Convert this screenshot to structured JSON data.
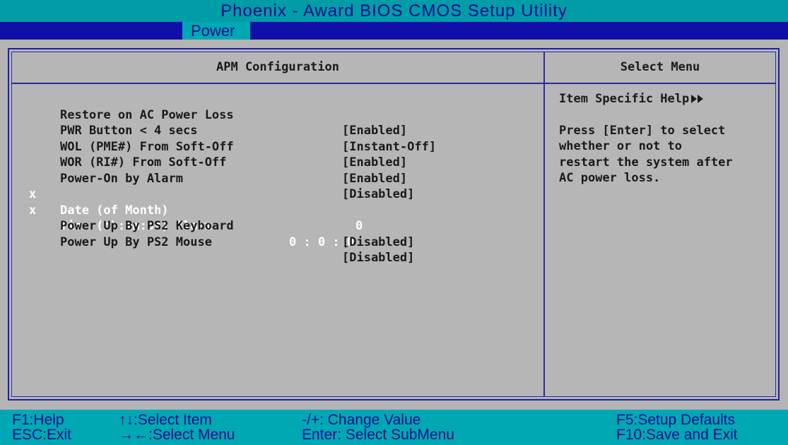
{
  "title": "Phoenix - Award BIOS CMOS Setup Utility",
  "menu": {
    "active_tab": "Power"
  },
  "panel": {
    "left_header": "APM Configuration",
    "right_header": "Select Menu"
  },
  "settings": [
    {
      "marker": "",
      "label": "Restore on AC Power Loss",
      "value": "[Enabled]"
    },
    {
      "marker": "",
      "label": "PWR Button < 4 secs",
      "value": "[Instant-Off]"
    },
    {
      "marker": "",
      "label": "WOL (PME#) From Soft-Off",
      "value": "[Enabled]"
    },
    {
      "marker": "",
      "label": "WOR (RI#) From Soft-Off",
      "value": "[Enabled]"
    },
    {
      "marker": "",
      "label": "Power-On by Alarm",
      "value": "[Disabled]"
    },
    {
      "marker": "x",
      "label": "Date (of Month)",
      "value": "0"
    },
    {
      "marker": "x",
      "label": "Time (hh:mm:ss) Alarm",
      "value": "0 : 0 : 0"
    },
    {
      "marker": "",
      "label": "Power Up By PS2 Keyboard",
      "value": "[Disabled]"
    },
    {
      "marker": "",
      "label": "Power Up By PS2 Mouse",
      "value": "[Disabled]"
    }
  ],
  "help": {
    "title": "Item Specific Help",
    "body": "Press [Enter] to select\nwhether or not to\nrestart the system after\nAC power loss."
  },
  "footer": {
    "f1": "F1:Help",
    "esc": "ESC:Exit",
    "select_item": "↑↓:Select Item",
    "select_menu": "→←:Select Menu",
    "change_value": "-/+: Change Value",
    "select_submenu": "Enter: Select SubMenu",
    "f5": "F5:Setup Defaults",
    "f10": "F10:Save and Exit"
  },
  "colors": {
    "title_bg": "#009ca8",
    "menubar_bg": "#1010a8",
    "panel_bg": "#b6b6b6",
    "disabled_text": "#ffffff",
    "border": "#2a2a9c"
  }
}
